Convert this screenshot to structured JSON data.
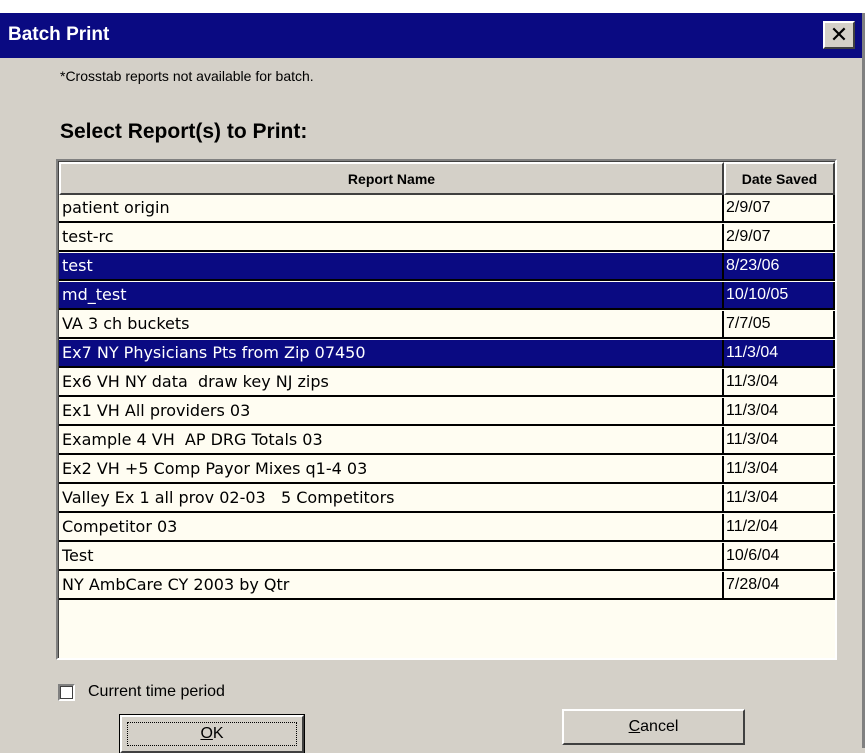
{
  "window": {
    "title": "Batch Print",
    "close_label": "✕"
  },
  "note": "*Crosstab reports not available for batch.",
  "heading": "Select Report(s) to Print:",
  "table": {
    "columns": [
      "Report Name",
      "Date Saved"
    ],
    "rows": [
      {
        "name": "patient origin",
        "date": "2/9/07",
        "selected": false
      },
      {
        "name": "test-rc",
        "date": "2/9/07",
        "selected": false
      },
      {
        "name": "test",
        "date": "8/23/06",
        "selected": true
      },
      {
        "name": "md_test",
        "date": "10/10/05",
        "selected": true
      },
      {
        "name": "VA 3 ch buckets",
        "date": "7/7/05",
        "selected": false
      },
      {
        "name": "Ex7 NY Physicians Pts from Zip 07450",
        "date": "11/3/04",
        "selected": true
      },
      {
        "name": "Ex6 VH NY data  draw key NJ zips",
        "date": "11/3/04",
        "selected": false
      },
      {
        "name": "Ex1 VH All providers 03",
        "date": "11/3/04",
        "selected": false
      },
      {
        "name": "Example 4 VH  AP DRG Totals 03",
        "date": "11/3/04",
        "selected": false
      },
      {
        "name": "Ex2 VH +5 Comp Payor Mixes q1-4 03",
        "date": "11/3/04",
        "selected": false
      },
      {
        "name": "Valley Ex 1 all prov 02-03   5 Competitors",
        "date": "11/3/04",
        "selected": false
      },
      {
        "name": "Competitor 03",
        "date": "11/2/04",
        "selected": false
      },
      {
        "name": "Test",
        "date": "10/6/04",
        "selected": false
      },
      {
        "name": "NY AmbCare CY 2003 by Qtr",
        "date": "7/28/04",
        "selected": false
      }
    ]
  },
  "checkbox": {
    "label": "Current time period",
    "checked": false
  },
  "buttons": {
    "ok_accel": "O",
    "ok_rest": "K",
    "cancel_accel": "C",
    "cancel_rest": "ancel"
  },
  "colors": {
    "title_bar": "#0a0a82",
    "selection": "#0a0a82",
    "dialog_bg": "#d4d0c8",
    "list_bg": "#fffdf2"
  }
}
